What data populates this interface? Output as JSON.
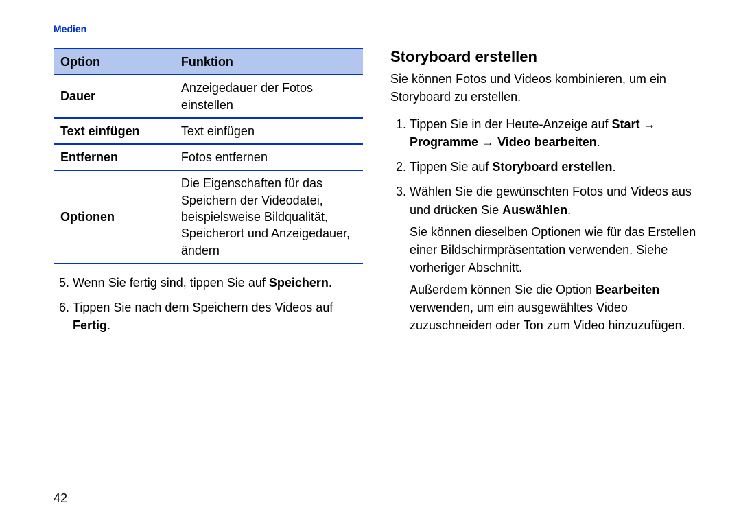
{
  "running_head": "Medien",
  "page_number": "42",
  "left": {
    "table": {
      "headers": {
        "col1": "Option",
        "col2": "Funktion"
      },
      "rows": [
        {
          "key": "Dauer",
          "val": "Anzeigedauer der Fotos einstellen"
        },
        {
          "key": "Text einfügen",
          "val": "Text einfügen"
        },
        {
          "key": "Entfernen",
          "val": "Fotos entfernen"
        },
        {
          "key": "Optionen",
          "val": "Die Eigenschaften für das Speichern der Videodatei, beispielsweise Bildqualität, Speicherort und Anzeigedauer, ändern"
        }
      ]
    },
    "steps_start": "5",
    "step5_a": "Wenn Sie fertig sind, tippen Sie auf ",
    "step5_b": "Speichern",
    "step5_c": ".",
    "step6_a": "Tippen Sie nach dem Speichern des Videos auf ",
    "step6_b": "Fertig",
    "step6_c": "."
  },
  "right": {
    "heading": "Storyboard erstellen",
    "lead": "Sie können Fotos und Videos kombinieren, um ein Storyboard zu erstellen.",
    "arrow": "→",
    "step1_a": "Tippen Sie in der Heute-Anzeige auf ",
    "step1_b": "Start",
    "step1_c": "Programme",
    "step1_d": "Video bearbeiten",
    "step1_e": ".",
    "step2_a": "Tippen Sie auf ",
    "step2_b": "Storyboard erstellen",
    "step2_c": ".",
    "step3_a": "Wählen Sie die gewünschten Fotos und Videos aus und drücken Sie ",
    "step3_b": "Auswählen",
    "step3_c": ".",
    "step3_sub1": "Sie können dieselben Optionen wie für das Erstellen einer Bildschirmpräsentation verwenden. Siehe vorheriger Abschnitt.",
    "step3_sub2_a": "Außerdem können Sie die Option ",
    "step3_sub2_b": "Bearbeiten",
    "step3_sub2_c": " verwenden, um ein ausgewähltes Video zuzuschneiden oder Ton zum Video hinzuzufügen."
  }
}
